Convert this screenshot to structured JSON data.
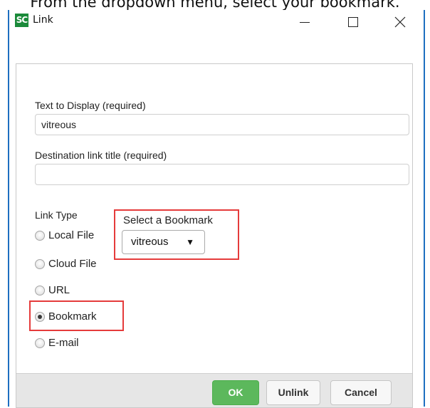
{
  "caption": "From the dropdown menu, select your bookmark.",
  "window": {
    "app_logo": "SC",
    "title": "Link",
    "controls": [
      "minimize",
      "maximize",
      "close"
    ]
  },
  "form": {
    "text_label": "Text to Display (required)",
    "text_value": "vitreous",
    "dest_label": "Destination link title (required)",
    "dest_value": "",
    "link_type_label": "Link Type",
    "link_types": [
      {
        "label": "Local File",
        "checked": false
      },
      {
        "label": "Cloud File",
        "checked": false
      },
      {
        "label": "URL",
        "checked": false
      },
      {
        "label": "Bookmark",
        "checked": true
      },
      {
        "label": "E-mail",
        "checked": false
      }
    ],
    "bookmark_label": "Select a Bookmark",
    "bookmark_value": "vitreous",
    "dropdown_arrow": "▼"
  },
  "buttons": {
    "ok": "OK",
    "unlink": "Unlink",
    "cancel": "Cancel"
  },
  "colors": {
    "window_border": "#1e6fc0",
    "highlight": "#e53b3b",
    "ok_button": "#5cb85c",
    "logo": "#1b8a3a"
  }
}
